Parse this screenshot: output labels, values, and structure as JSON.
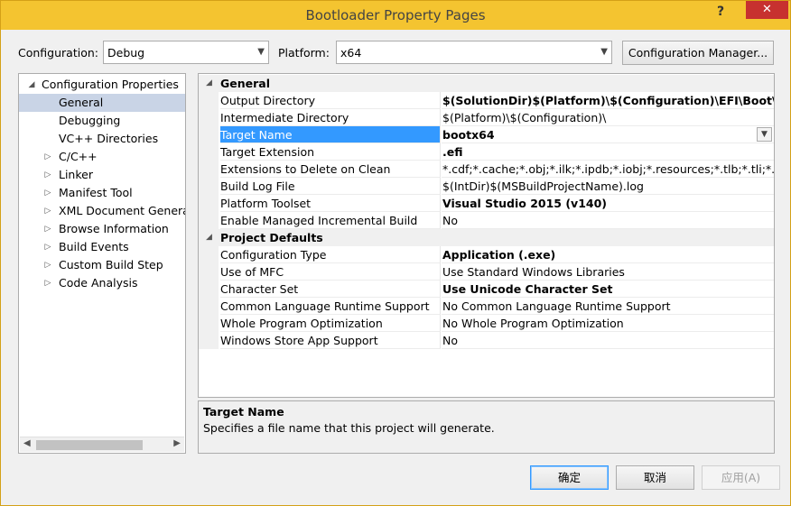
{
  "window": {
    "title": "Bootloader Property Pages",
    "help_glyph": "?",
    "close_glyph": "✕"
  },
  "toolbar": {
    "configuration_label": "Configuration:",
    "configuration_value": "Debug",
    "platform_label": "Platform:",
    "platform_value": "x64",
    "config_manager_label": "Configuration Manager..."
  },
  "tree": {
    "items": [
      {
        "label": "Configuration Properties",
        "expander": "◢"
      },
      {
        "label": "General",
        "expander": ""
      },
      {
        "label": "Debugging",
        "expander": ""
      },
      {
        "label": "VC++ Directories",
        "expander": ""
      },
      {
        "label": "C/C++",
        "expander": "▷"
      },
      {
        "label": "Linker",
        "expander": "▷"
      },
      {
        "label": "Manifest Tool",
        "expander": "▷"
      },
      {
        "label": "XML Document Generat",
        "expander": "▷"
      },
      {
        "label": "Browse Information",
        "expander": "▷"
      },
      {
        "label": "Build Events",
        "expander": "▷"
      },
      {
        "label": "Custom Build Step",
        "expander": "▷"
      },
      {
        "label": "Code Analysis",
        "expander": "▷"
      }
    ],
    "selected": "General"
  },
  "grid": {
    "categories": [
      {
        "label": "General",
        "expander": "◢",
        "rows": [
          {
            "name": "Output Directory",
            "value": "$(SolutionDir)$(Platform)\\$(Configuration)\\EFI\\Boot\\",
            "bold": true
          },
          {
            "name": "Intermediate Directory",
            "value": "$(Platform)\\$(Configuration)\\",
            "bold": false
          },
          {
            "name": "Target Name",
            "value": "bootx64",
            "bold": true
          },
          {
            "name": "Target Extension",
            "value": ".efi",
            "bold": true
          },
          {
            "name": "Extensions to Delete on Clean",
            "value": "*.cdf;*.cache;*.obj;*.ilk;*.ipdb;*.iobj;*.resources;*.tlb;*.tli;*.tlh;*.tmp",
            "bold": false
          },
          {
            "name": "Build Log File",
            "value": "$(IntDir)$(MSBuildProjectName).log",
            "bold": false
          },
          {
            "name": "Platform Toolset",
            "value": "Visual Studio 2015 (v140)",
            "bold": true
          },
          {
            "name": "Enable Managed Incremental Build",
            "value": "No",
            "bold": false
          }
        ]
      },
      {
        "label": "Project Defaults",
        "expander": "◢",
        "rows": [
          {
            "name": "Configuration Type",
            "value": "Application (.exe)",
            "bold": true
          },
          {
            "name": "Use of MFC",
            "value": "Use Standard Windows Libraries",
            "bold": false
          },
          {
            "name": "Character Set",
            "value": "Use Unicode Character Set",
            "bold": true
          },
          {
            "name": "Common Language Runtime Support",
            "value": "No Common Language Runtime Support",
            "bold": false
          },
          {
            "name": "Whole Program Optimization",
            "value": "No Whole Program Optimization",
            "bold": false
          },
          {
            "name": "Windows Store App Support",
            "value": "No",
            "bold": false
          }
        ]
      }
    ],
    "selected": "Target Name"
  },
  "description": {
    "title": "Target Name",
    "text": "Specifies a file name that this project will generate."
  },
  "buttons": {
    "ok": "确定",
    "cancel": "取消",
    "apply": "应用(A)"
  },
  "colors": {
    "titlebar": "#f4c430",
    "selection": "#3399ff",
    "tree_selection": "#c9d4e6",
    "close": "#c7312f"
  }
}
